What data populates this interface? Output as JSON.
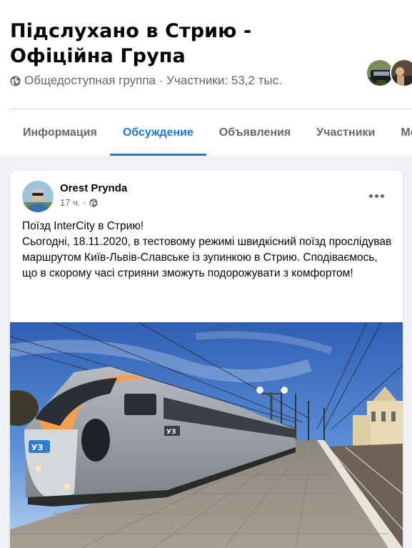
{
  "group": {
    "title": "Підслухано в Стрию - Офіційна Група",
    "meta": "Общедоступная группа · Участники: 53,2 тыс."
  },
  "tabs": [
    {
      "label": "Информация",
      "active": false
    },
    {
      "label": "Обсуждение",
      "active": true
    },
    {
      "label": "Объявления",
      "active": false
    },
    {
      "label": "Участники",
      "active": false
    },
    {
      "label": "Ме",
      "active": false
    }
  ],
  "post": {
    "author": "Orest Prynda",
    "time": "17 ч.",
    "dot": "·",
    "lines": [
      "Поїзд InterCity в Стрию!",
      "Сьогодні, 18.11.2020, в тестовому режимі швидкісний поїзд прослідував маршрутом Київ-Львів-Славське із зупинкою в Стрию. Сподіваємось, що в скорому часі стрияни зможуть подорожувати з комфортом!"
    ],
    "image_train_logo": "УЗ"
  },
  "icons": {
    "privacy": "globe-icon",
    "more": "more-options-icon"
  },
  "colors": {
    "accent": "#1877f2",
    "secondary_text": "#65676b",
    "train_stripe": "#f4a04a"
  }
}
